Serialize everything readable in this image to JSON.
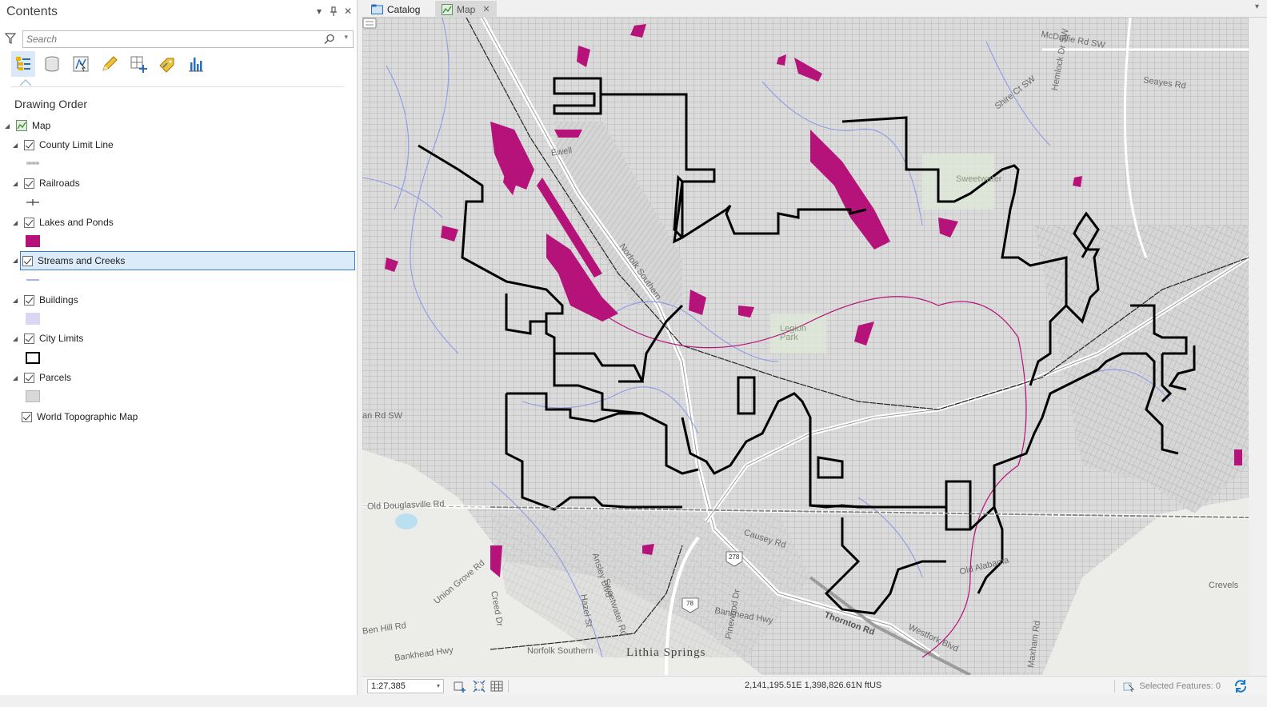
{
  "contents": {
    "title": "Contents",
    "search_placeholder": "Search",
    "section_title": "Drawing Order",
    "map_node": "Map",
    "layers": [
      {
        "name": "County Limit Line",
        "checked": true
      },
      {
        "name": "Railroads",
        "checked": true
      },
      {
        "name": "Lakes and Ponds",
        "checked": true
      },
      {
        "name": "Streams and Creeks",
        "checked": true,
        "selected": true
      },
      {
        "name": "Buildings",
        "checked": true
      },
      {
        "name": "City Limits",
        "checked": true
      },
      {
        "name": "Parcels",
        "checked": true
      },
      {
        "name": "World Topographic Map",
        "checked": true
      }
    ],
    "toolbar_icons": [
      "list-by-drawing-order-icon",
      "list-by-source-icon",
      "list-by-selection-icon",
      "list-by-editing-icon",
      "list-by-snapping-icon",
      "list-by-labeling-icon",
      "list-by-charts-icon"
    ]
  },
  "tabs": [
    {
      "label": "Catalog",
      "active": false
    },
    {
      "label": "Map",
      "active": true
    }
  ],
  "map": {
    "labels": {
      "mcduffie": "McDuffie Rd SW",
      "seayes": "Seayes Rd",
      "hemlock": "Hemlock Dr SW",
      "shire": "Shire Ct SW",
      "sweetwater": "Sweetwater",
      "legion": "Legion Park",
      "norfolk_top": "Norfolk Southern",
      "ewell": "Ewell",
      "san_rd": "an Rd SW",
      "old_douglasville": "Old Douglasville Rd",
      "causey": "Causey Rd",
      "old_alabama": "Old Alabama",
      "union_grove": "Union Grove Rd",
      "creed": "Creed Dr",
      "ansley": "Ansley Blvd",
      "hazel": "Hazel St",
      "sweetwater_rd": "Sweetwater Rd",
      "ben_hill": "Ben Hill Rd",
      "bankhead_hwy": "Bankhead Hwy",
      "bankhead_hwy2": "Bankhead Hwy",
      "norfolk_bottom": "Norfolk Southern",
      "lithia": "Lithia Springs",
      "pinewood": "Pinewood Dr",
      "thornton": "Thornton Rd",
      "westfork": "Westfork Blvd",
      "maxham": "Maxham Rd",
      "crevels": "Crevels",
      "route_278": "278",
      "route_78": "78"
    }
  },
  "status": {
    "scale": "1:27,385",
    "coordinates": "2,141,195.51E 1,398,826.61N ftUS",
    "selected_features": "Selected Features: 0"
  },
  "colors": {
    "lakes": "#b5137a",
    "streams": "#8e9be6",
    "buildings": "#ddd6f2",
    "parcels": "#d8d8d8",
    "city_limits": "#000000",
    "selection": "#3d7cc4"
  }
}
